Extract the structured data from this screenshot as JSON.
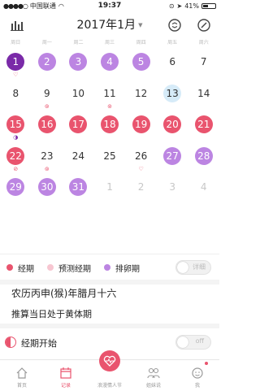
{
  "status": {
    "carrier": "中国联通",
    "time": "19:37",
    "battery": "41%"
  },
  "header": {
    "month": "2017年1月"
  },
  "weekdays": [
    "周日",
    "周一",
    "周二",
    "周三",
    "周四",
    "周五",
    "周六"
  ],
  "calendar": [
    [
      "1",
      "2",
      "3",
      "4",
      "5",
      "6",
      "7"
    ],
    [
      "8",
      "9",
      "10",
      "11",
      "12",
      "13",
      "14"
    ],
    [
      "15",
      "16",
      "17",
      "18",
      "19",
      "20",
      "21"
    ],
    [
      "22",
      "23",
      "24",
      "25",
      "26",
      "27",
      "28"
    ],
    [
      "29",
      "30",
      "31",
      "1",
      "2",
      "3",
      "4"
    ]
  ],
  "legend": {
    "period": "经期",
    "predicted": "预测经期",
    "ovulation": "排卵期",
    "detail_toggle": "详细"
  },
  "info": {
    "lunar": "农历丙申(猴)年腊月十六",
    "phase": "推算当日处于黄体期"
  },
  "period_start": {
    "label": "经期开始",
    "toggle": "off"
  },
  "tabs": [
    "首页",
    "记录",
    "浪漫情人节",
    "姐妹说",
    "我"
  ],
  "colors": {
    "period": "#e9546e",
    "predicted": "#f7c6d1",
    "ovulation": "#bc85e2",
    "ovulation_day": "#7a2aa8",
    "today": "#d6ebf8"
  }
}
